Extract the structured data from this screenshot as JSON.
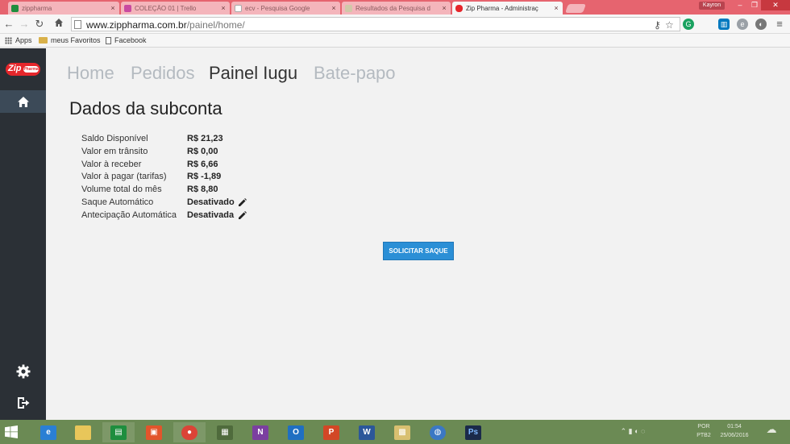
{
  "browser": {
    "tabs": [
      {
        "title": "zippharma",
        "color": "#1e8e3e"
      },
      {
        "title": "COLEÇÃO 01 | Trello",
        "color": "#c94aa0"
      },
      {
        "title": "ecv - Pesquisa Google",
        "color": "#d9d9d9"
      },
      {
        "title": "Resultados da Pesquisa d",
        "color": "#d9d9d9"
      },
      {
        "title": "Zip Pharma - Administraç",
        "color": "#e5262b"
      }
    ],
    "user_badge": "Kayron",
    "url_host": "www.zippharma.com.br",
    "url_path": "/painel/home/",
    "bookmarks": [
      {
        "label": "Apps"
      },
      {
        "label": "meus Favoritos"
      },
      {
        "label": "Facebook"
      }
    ]
  },
  "app": {
    "logo_text": "Zip",
    "logo_sub": "Pharma",
    "nav": [
      {
        "label": "Home"
      },
      {
        "label": "Pedidos"
      },
      {
        "label": "Painel Iugu"
      },
      {
        "label": "Bate-papo"
      }
    ],
    "section_title": "Dados da subconta",
    "account_rows": [
      {
        "label": "Saldo Disponível",
        "value": "R$ 21,23"
      },
      {
        "label": "Valor em trânsito",
        "value": "R$ 0,00"
      },
      {
        "label": "Valor à receber",
        "value": "R$ 6,66"
      },
      {
        "label": "Valor à pagar (tarifas)",
        "value": "R$ -1,89"
      },
      {
        "label": "Volume total do mês",
        "value": "R$ 8,80"
      },
      {
        "label": "Saque Automático",
        "value": "Desativado"
      },
      {
        "label": "Antecipação Automática",
        "value": "Desativada"
      }
    ],
    "withdraw_button": "SOLICITAR SAQUE"
  },
  "taskbar": {
    "time": "01:54",
    "date": "25/06/2016",
    "lang": "POR",
    "lang_sub": "PTB2"
  }
}
